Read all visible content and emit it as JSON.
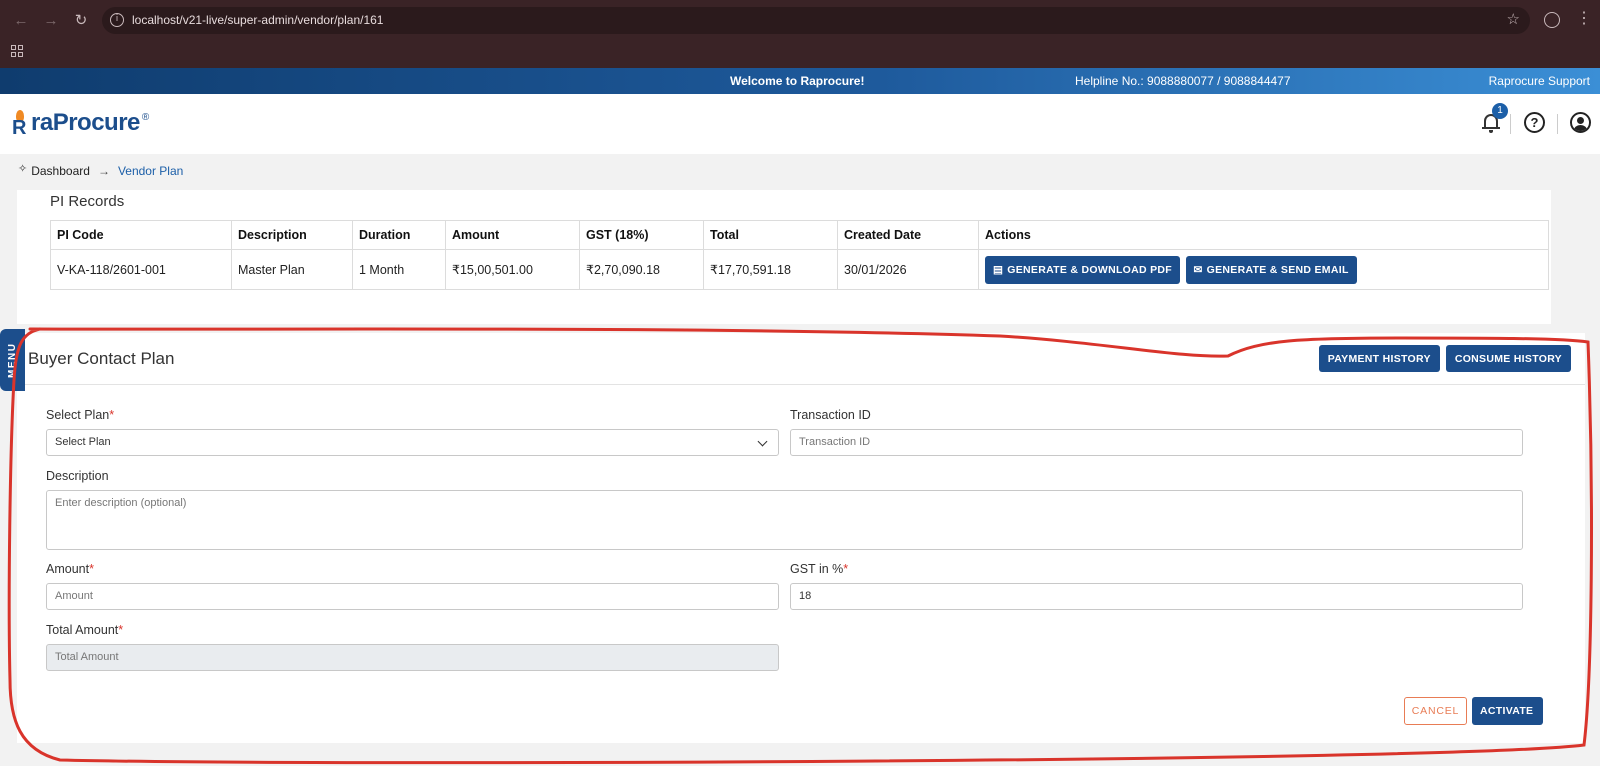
{
  "browser": {
    "back_icon": "arrow-left-icon",
    "url": "localhost/v21-live/super-admin/vendor/plan/161"
  },
  "topstrip": {
    "welcome": "Welcome to Raprocure!",
    "helpline": "Helpline No.: 9088880077 / 9088844477",
    "support": "Raprocure Support"
  },
  "header": {
    "logo_text": "raProcure",
    "logo_registered": "®",
    "notification_count": "1"
  },
  "breadcrumb": {
    "home": "Dashboard",
    "current": "Vendor Plan"
  },
  "pi_records": {
    "title": "PI Records",
    "columns": [
      "PI Code",
      "Description",
      "Duration",
      "Amount",
      "GST (18%)",
      "Total",
      "Created Date",
      "Actions"
    ],
    "rows": [
      {
        "pi_code": "V-KA-118/2601-001",
        "description": "Master Plan",
        "duration": "1 Month",
        "amount": "₹15,00,501.00",
        "gst": "₹2,70,090.18",
        "total": "₹17,70,591.18",
        "created_date": "30/01/2026"
      }
    ],
    "btn_pdf": "GENERATE & DOWNLOAD PDF",
    "btn_email": "GENERATE & SEND EMAIL"
  },
  "buyer_plan": {
    "title": "Buyer Contact Plan",
    "btn_payment_history": "PAYMENT HISTORY",
    "btn_consume_history": "CONSUME HISTORY",
    "menu_tab": "MENU",
    "select_plan_label": "Select Plan",
    "select_plan_value": "Select Plan",
    "transaction_label": "Transaction ID",
    "transaction_placeholder": "Transaction ID",
    "description_label": "Description",
    "description_placeholder": "Enter description (optional)",
    "amount_label": "Amount",
    "amount_placeholder": "Amount",
    "gst_label": "GST in %",
    "gst_value": "18",
    "total_label": "Total Amount",
    "total_placeholder": "Total Amount",
    "required_mark": "*",
    "btn_cancel": "CANCEL",
    "btn_activate": "ACTIVATE"
  },
  "colors": {
    "primary": "#1c4e8c",
    "cancel": "#e87c55",
    "required": "#d9342b",
    "annotation": "#d9342b"
  }
}
